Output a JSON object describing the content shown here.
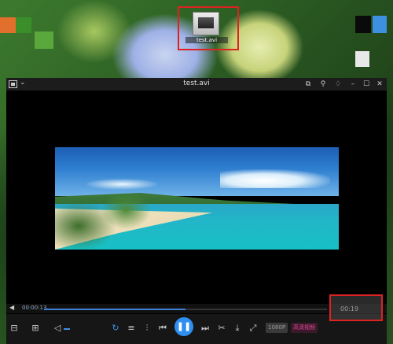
{
  "desktop": {
    "icon_label": "test.avi"
  },
  "player": {
    "title": "test.avi",
    "titlebar_icons": [
      "app-menu-icon",
      "chevron-down-icon",
      "screenshot-icon",
      "pin-icon",
      "menu-icon",
      "minimize-icon",
      "maximize-icon",
      "close-icon"
    ],
    "current_time": "00:00:13",
    "duration": "00:19",
    "progress_percent": 50,
    "controls": {
      "labels": [
        "tray",
        "folder",
        "volume",
        "loop",
        "list",
        "settings",
        "prev",
        "pause",
        "next",
        "cut",
        "download",
        "fullscreen"
      ],
      "quality_badge": "1080P",
      "hd_badge": "高清视频"
    },
    "colors": {
      "accent": "#2f8ff0",
      "highlight_box": "#dd2222",
      "badge_pink": "#e0469a"
    }
  }
}
